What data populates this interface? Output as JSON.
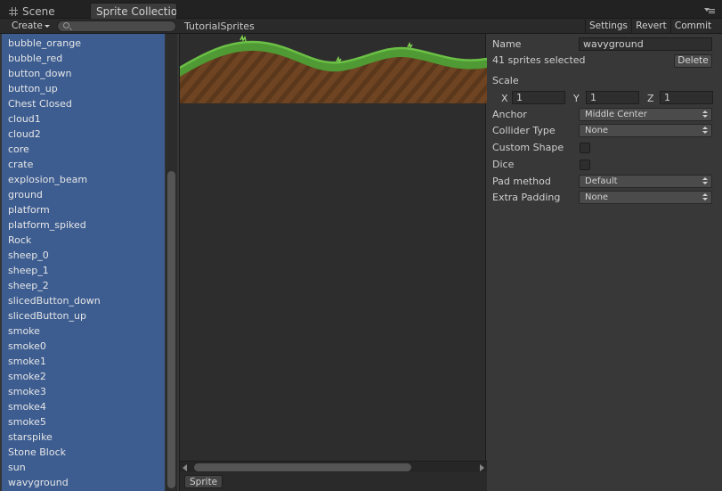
{
  "tabs": [
    {
      "label": "Scene",
      "icon": "grid-icon",
      "active": false
    },
    {
      "label": "Sprite Collectio",
      "active": true
    }
  ],
  "toolbar": {
    "create_label": "Create",
    "collection_name": "TutorialSprites",
    "settings_label": "Settings",
    "revert_label": "Revert",
    "commit_label": "Commit"
  },
  "sprite_list": [
    "bubble_orange",
    "bubble_red",
    "button_down",
    "button_up",
    "Chest Closed",
    "cloud1",
    "cloud2",
    "core",
    "crate",
    "explosion_beam",
    "ground",
    "platform",
    "platform_spiked",
    "Rock",
    "sheep_0",
    "sheep_1",
    "sheep_2",
    "slicedButton_down",
    "slicedButton_up",
    "smoke",
    "smoke0",
    "smoke1",
    "smoke2",
    "smoke3",
    "smoke4",
    "smoke5",
    "starspike",
    "Stone Block",
    "sun",
    "wavyground"
  ],
  "preview": {
    "footer_tag": "Sprite"
  },
  "inspector": {
    "name_label": "Name",
    "name_value": "wavyground",
    "selection_text": "41 sprites selected",
    "delete_label": "Delete",
    "scale_label": "Scale",
    "scale": {
      "x_label": "X",
      "x": "1",
      "y_label": "Y",
      "y": "1",
      "z_label": "Z",
      "z": "1"
    },
    "anchor_label": "Anchor",
    "anchor_value": "Middle Center",
    "collider_label": "Collider Type",
    "collider_value": "None",
    "custom_shape_label": "Custom Shape",
    "custom_shape_checked": false,
    "dice_label": "Dice",
    "dice_checked": false,
    "pad_method_label": "Pad method",
    "pad_method_value": "Default",
    "extra_padding_label": "Extra Padding",
    "extra_padding_value": "None"
  },
  "colors": {
    "selection_blue": "#3d5d91",
    "panel_bg": "#383838",
    "grass": "#4f9a34",
    "dirt": "#6e4422"
  }
}
